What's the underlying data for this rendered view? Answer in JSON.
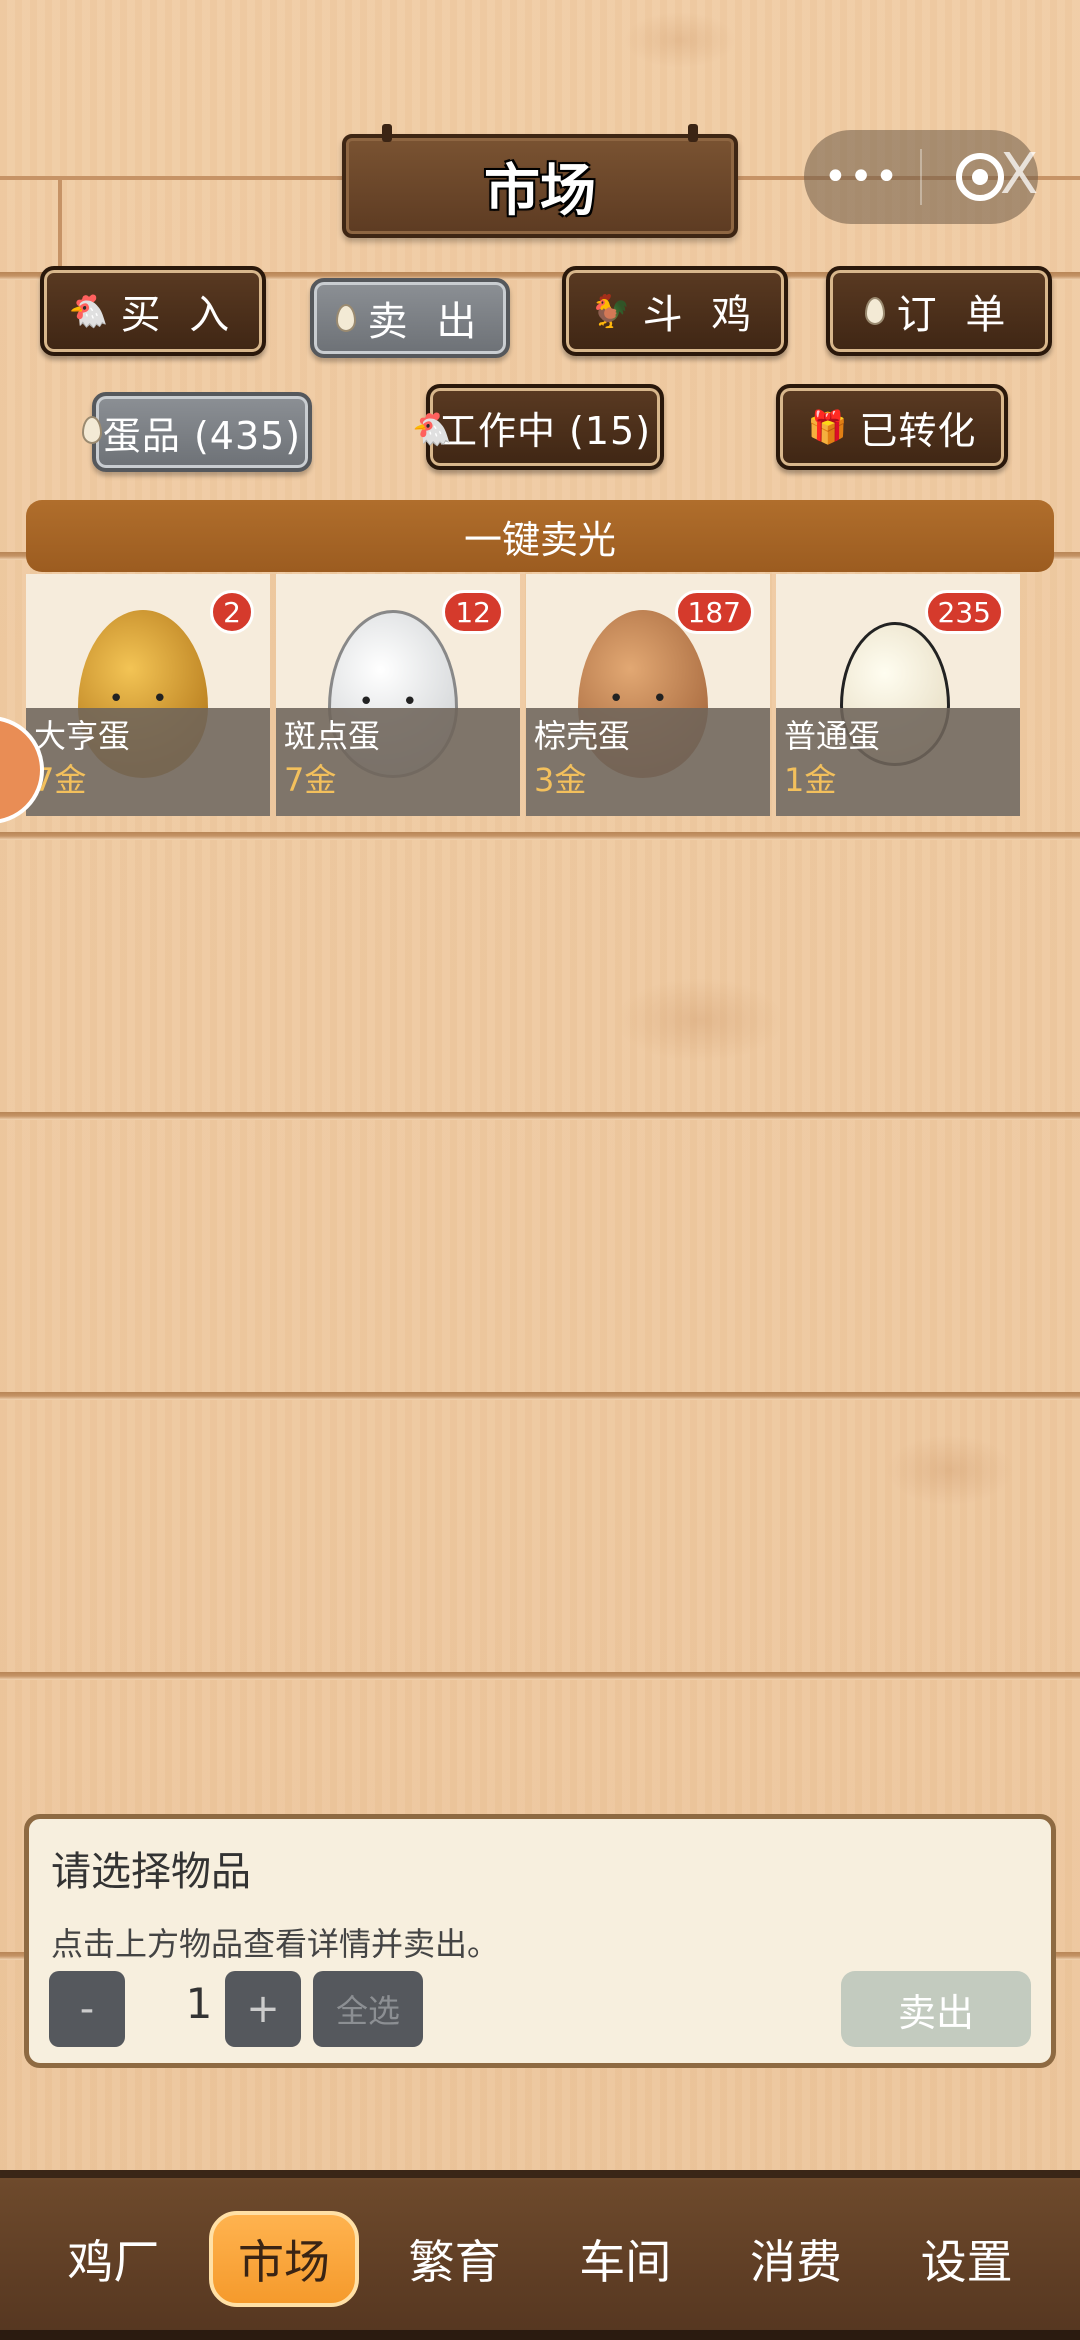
{
  "header": {
    "title": "市场",
    "capsule_more": "•••",
    "capsule_close": "X"
  },
  "tabs": [
    {
      "label": "买 入",
      "icon": "chicken-icon",
      "state": "dark"
    },
    {
      "label": "卖 出",
      "icon": "egg-icon",
      "state": "selected-grey"
    },
    {
      "label": "斗 鸡",
      "icon": "black-chicken-icon",
      "state": "dark"
    },
    {
      "label": "订 单",
      "icon": "egg-icon",
      "state": "dark"
    }
  ],
  "subtabs": [
    {
      "label": "蛋品 (435)",
      "icon": "egg-icon",
      "state": "selected-grey"
    },
    {
      "label": "工作中 (15)",
      "icon": "chicken-icon",
      "state": "dark"
    },
    {
      "label": "已转化",
      "icon": "gift-icon",
      "state": "dark"
    }
  ],
  "sell_all_label": "一键卖光",
  "items": [
    {
      "name": "大亨蛋",
      "price": "7金",
      "count": "2"
    },
    {
      "name": "斑点蛋",
      "price": "7金",
      "count": "12"
    },
    {
      "name": "棕壳蛋",
      "price": "3金",
      "count": "187"
    },
    {
      "name": "普通蛋",
      "price": "1金",
      "count": "235"
    }
  ],
  "panel": {
    "title": "请选择物品",
    "description": "点击上方物品查看详情并卖出。",
    "minus": "-",
    "quantity": "1",
    "plus": "+",
    "select_all": "全选",
    "sell": "卖出"
  },
  "nav": [
    {
      "label": "鸡厂",
      "active": false
    },
    {
      "label": "市场",
      "active": true
    },
    {
      "label": "繁育",
      "active": false
    },
    {
      "label": "车间",
      "active": false
    },
    {
      "label": "消费",
      "active": false
    },
    {
      "label": "设置",
      "active": false
    }
  ],
  "colors": {
    "accent_orange": "#f59a2c",
    "sell_all_bar": "#a8652a",
    "badge_red": "#d53a2c",
    "price_gold": "#f3c05c"
  }
}
